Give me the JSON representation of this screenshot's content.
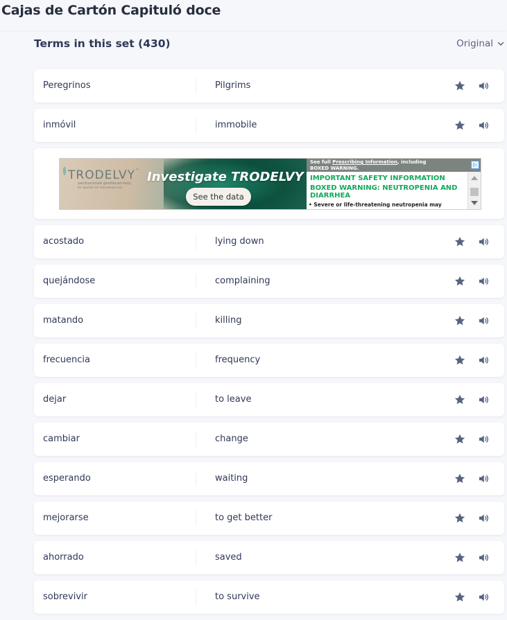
{
  "header": {
    "title": "Cajas de Cartón Capituló doce"
  },
  "section": {
    "terms_title": "Terms in this set (430)",
    "sort_label": "Original"
  },
  "colors": {
    "star": "#586380",
    "audio": "#586380",
    "text": "#2e3856",
    "ad_green": "#13a85a"
  },
  "icons": {
    "star": "star-icon",
    "audio": "speaker-icon",
    "sort": "chevron-down-icon"
  },
  "terms_before_ad": [
    {
      "term": "Peregrinos",
      "definition": "Pilgrims"
    },
    {
      "term": "inmóvil",
      "definition": "immobile"
    }
  ],
  "ad": {
    "brand": "TRODELVY",
    "brand_tm": "™",
    "brand_sub": "sacituzumab govitecan-hziy",
    "brand_sub2": "for injection for intravenous use",
    "headline": "Investigate TRODELVY",
    "cta": "See the data",
    "pi_line1_prefix": "See full ",
    "pi_line1_link": "Prescribing Information",
    "pi_line1_suffix": ", including",
    "pi_line2": "BOXED WARNING.",
    "safety": "IMPORTANT SAFETY INFORMATION",
    "boxed": "BOXED WARNING: NEUTROPENIA AND DIARRHEA",
    "bullet": "• Severe or life-threatening neutropenia may",
    "choices": "▷"
  },
  "terms_after_ad": [
    {
      "term": "acostado",
      "definition": "lying down"
    },
    {
      "term": "quejándose",
      "definition": "complaining"
    },
    {
      "term": "matando",
      "definition": "killing"
    },
    {
      "term": "frecuencia",
      "definition": "frequency"
    },
    {
      "term": "dejar",
      "definition": "to leave"
    },
    {
      "term": "cambiar",
      "definition": "change"
    },
    {
      "term": "esperando",
      "definition": "waiting"
    },
    {
      "term": "mejorarse",
      "definition": "to get better"
    },
    {
      "term": "ahorrado",
      "definition": "saved"
    },
    {
      "term": "sobrevivir",
      "definition": "to survive"
    }
  ]
}
